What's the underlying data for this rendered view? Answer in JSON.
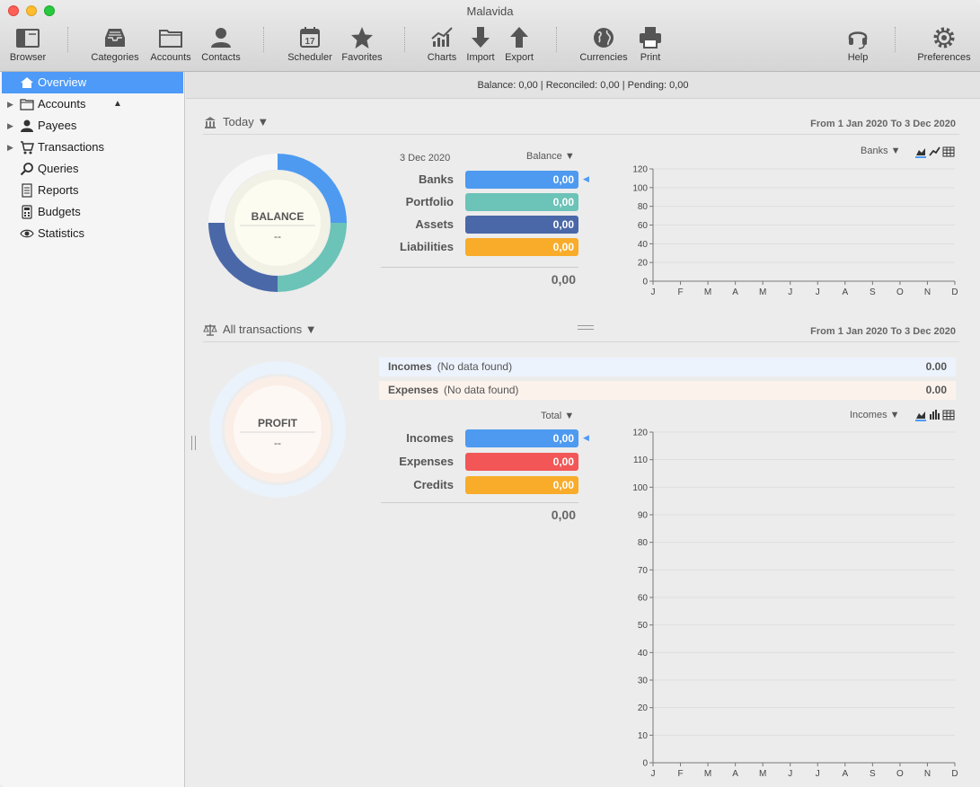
{
  "window": {
    "title": "Malavida"
  },
  "toolbar": {
    "browser": "Browser",
    "categories": "Categories",
    "accounts": "Accounts",
    "contacts": "Contacts",
    "scheduler": "Scheduler",
    "favorites": "Favorites",
    "charts": "Charts",
    "import": "Import",
    "export": "Export",
    "currencies": "Currencies",
    "print": "Print",
    "help": "Help",
    "preferences": "Preferences",
    "scheduler_day": "17"
  },
  "sidebar": {
    "items": [
      {
        "label": "Overview"
      },
      {
        "label": "Accounts"
      },
      {
        "label": "Payees"
      },
      {
        "label": "Transactions"
      },
      {
        "label": "Queries"
      },
      {
        "label": "Reports"
      },
      {
        "label": "Budgets"
      },
      {
        "label": "Statistics"
      }
    ],
    "selected": "Overview"
  },
  "status": {
    "text": "Balance: 0,00 | Reconciled: 0,00 | Pending: 0,00"
  },
  "balance_section": {
    "title": "Today",
    "range": "From 1 Jan 2020 To 3 Dec 2020",
    "donut_title": "BALANCE",
    "donut_value": "--",
    "date": "3 Dec 2020",
    "mode": "Balance",
    "categories": [
      {
        "label": "Banks",
        "value": "0,00",
        "color": "#4d9af0"
      },
      {
        "label": "Portfolio",
        "value": "0,00",
        "color": "#6cc3b8"
      },
      {
        "label": "Assets",
        "value": "0,00",
        "color": "#4a68a8"
      },
      {
        "label": "Liabilities",
        "value": "0,00",
        "color": "#f8ac2a"
      }
    ],
    "total": "0,00",
    "chart_selector": "Banks"
  },
  "transactions_section": {
    "title": "All transactions",
    "range": "From 1 Jan 2020 To 3 Dec 2020",
    "donut_title": "PROFIT",
    "donut_value": "--",
    "incomes_label": "Incomes",
    "incomes_note": "(No data found)",
    "incomes_value": "0.00",
    "expenses_label": "Expenses",
    "expenses_note": "(No data found)",
    "expenses_value": "0.00",
    "mode": "Total",
    "categories": [
      {
        "label": "Incomes",
        "value": "0,00",
        "color": "#4d9af0"
      },
      {
        "label": "Expenses",
        "value": "0,00",
        "color": "#f25656"
      },
      {
        "label": "Credits",
        "value": "0,00",
        "color": "#f8ac2a"
      }
    ],
    "total": "0,00",
    "chart_selector": "Incomes"
  },
  "colors": {
    "accent": "#4d9af8",
    "donut_balance": [
      "#4d9af0",
      "#6cc3b8",
      "#4a68a8"
    ]
  },
  "chart_data": [
    {
      "type": "area",
      "title": "",
      "categories": [
        "J",
        "F",
        "M",
        "A",
        "M",
        "J",
        "J",
        "A",
        "S",
        "O",
        "N",
        "D"
      ],
      "series": [
        {
          "name": "Banks",
          "values": [
            0,
            0,
            0,
            0,
            0,
            0,
            0,
            0,
            0,
            0,
            0,
            0
          ]
        }
      ],
      "ylim": [
        0,
        120
      ],
      "yticks": [
        0,
        20,
        40,
        60,
        80,
        100,
        120
      ],
      "grid": true
    },
    {
      "type": "area",
      "title": "",
      "categories": [
        "J",
        "F",
        "M",
        "A",
        "M",
        "J",
        "J",
        "A",
        "S",
        "O",
        "N",
        "D"
      ],
      "series": [
        {
          "name": "Incomes",
          "values": [
            0,
            0,
            0,
            0,
            0,
            0,
            0,
            0,
            0,
            0,
            0,
            0
          ]
        }
      ],
      "ylim": [
        0,
        120
      ],
      "yticks": [
        0,
        10,
        20,
        30,
        40,
        50,
        60,
        70,
        80,
        90,
        100,
        110,
        120
      ],
      "grid": true
    }
  ]
}
